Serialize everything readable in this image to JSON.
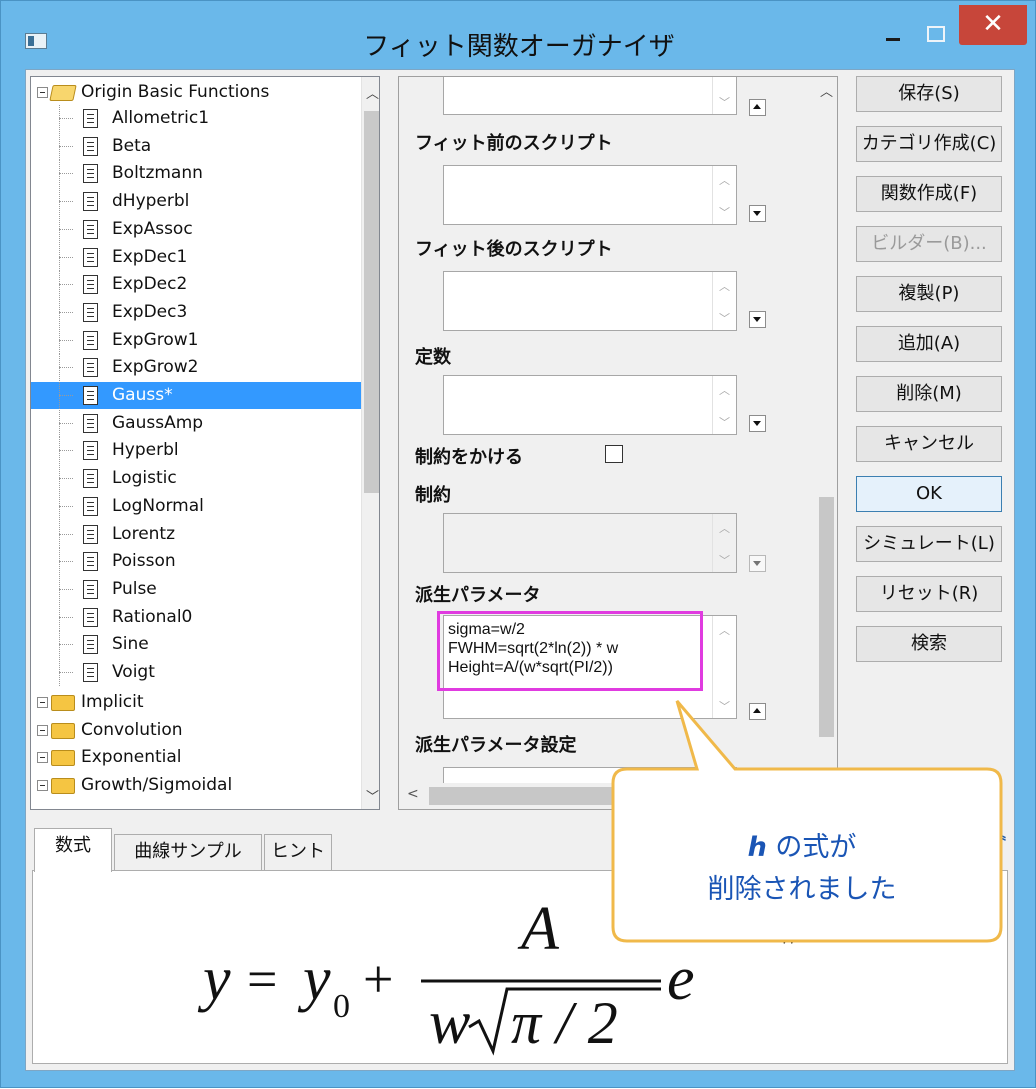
{
  "window": {
    "title": "フィット関数オーガナイザ",
    "close_glyph": "✕"
  },
  "tree": {
    "root_label": "Origin Basic Functions",
    "functions": [
      "Allometric1",
      "Beta",
      "Boltzmann",
      "dHyperbl",
      "ExpAssoc",
      "ExpDec1",
      "ExpDec2",
      "ExpDec3",
      "ExpGrow1",
      "ExpGrow2",
      "Gauss*",
      "GaussAmp",
      "Hyperbl",
      "Logistic",
      "LogNormal",
      "Lorentz",
      "Poisson",
      "Pulse",
      "Rational0",
      "Sine",
      "Voigt"
    ],
    "selected": "Gauss*",
    "categories": [
      "Implicit",
      "Convolution",
      "Exponential",
      "Growth/Sigmoidal"
    ]
  },
  "middle": {
    "pre_fit_script": "フィット前のスクリプト",
    "post_fit_script": "フィット後のスクリプト",
    "constants": "定数",
    "apply_constraints": "制約をかける",
    "constraints": "制約",
    "derived_params": "派生パラメータ",
    "derived_params_value": "sigma=w/2\nFWHM=sqrt(2*ln(2)) * w\nHeight=A/(w*sqrt(PI/2))",
    "derived_params_settings": "派生パラメータ設定"
  },
  "buttons": {
    "save": "保存(S)",
    "new_category": "カテゴリ作成(C)",
    "new_function": "関数作成(F)",
    "builder": "ビルダー(B)...",
    "duplicate": "複製(P)",
    "add": "追加(A)",
    "delete": "削除(M)",
    "cancel": "キャンセル",
    "ok": "OK",
    "simulate": "シミュレート(L)",
    "reset": "リセット(R)",
    "search": "検索"
  },
  "tabs": [
    "数式",
    "曲線サンプル",
    "ヒント"
  ],
  "equation": {
    "lhs": "y",
    "y0": "y",
    "y0_sub": "0",
    "numerator": "A",
    "denominator_w": "w",
    "pi_over_2": "π / 2",
    "exp": "e",
    "exp_partial": "w"
  },
  "callout": {
    "h_letter": "h",
    "line1_suffix": " の式が",
    "line2": "削除されました",
    "border_color": "#f0b94a"
  }
}
